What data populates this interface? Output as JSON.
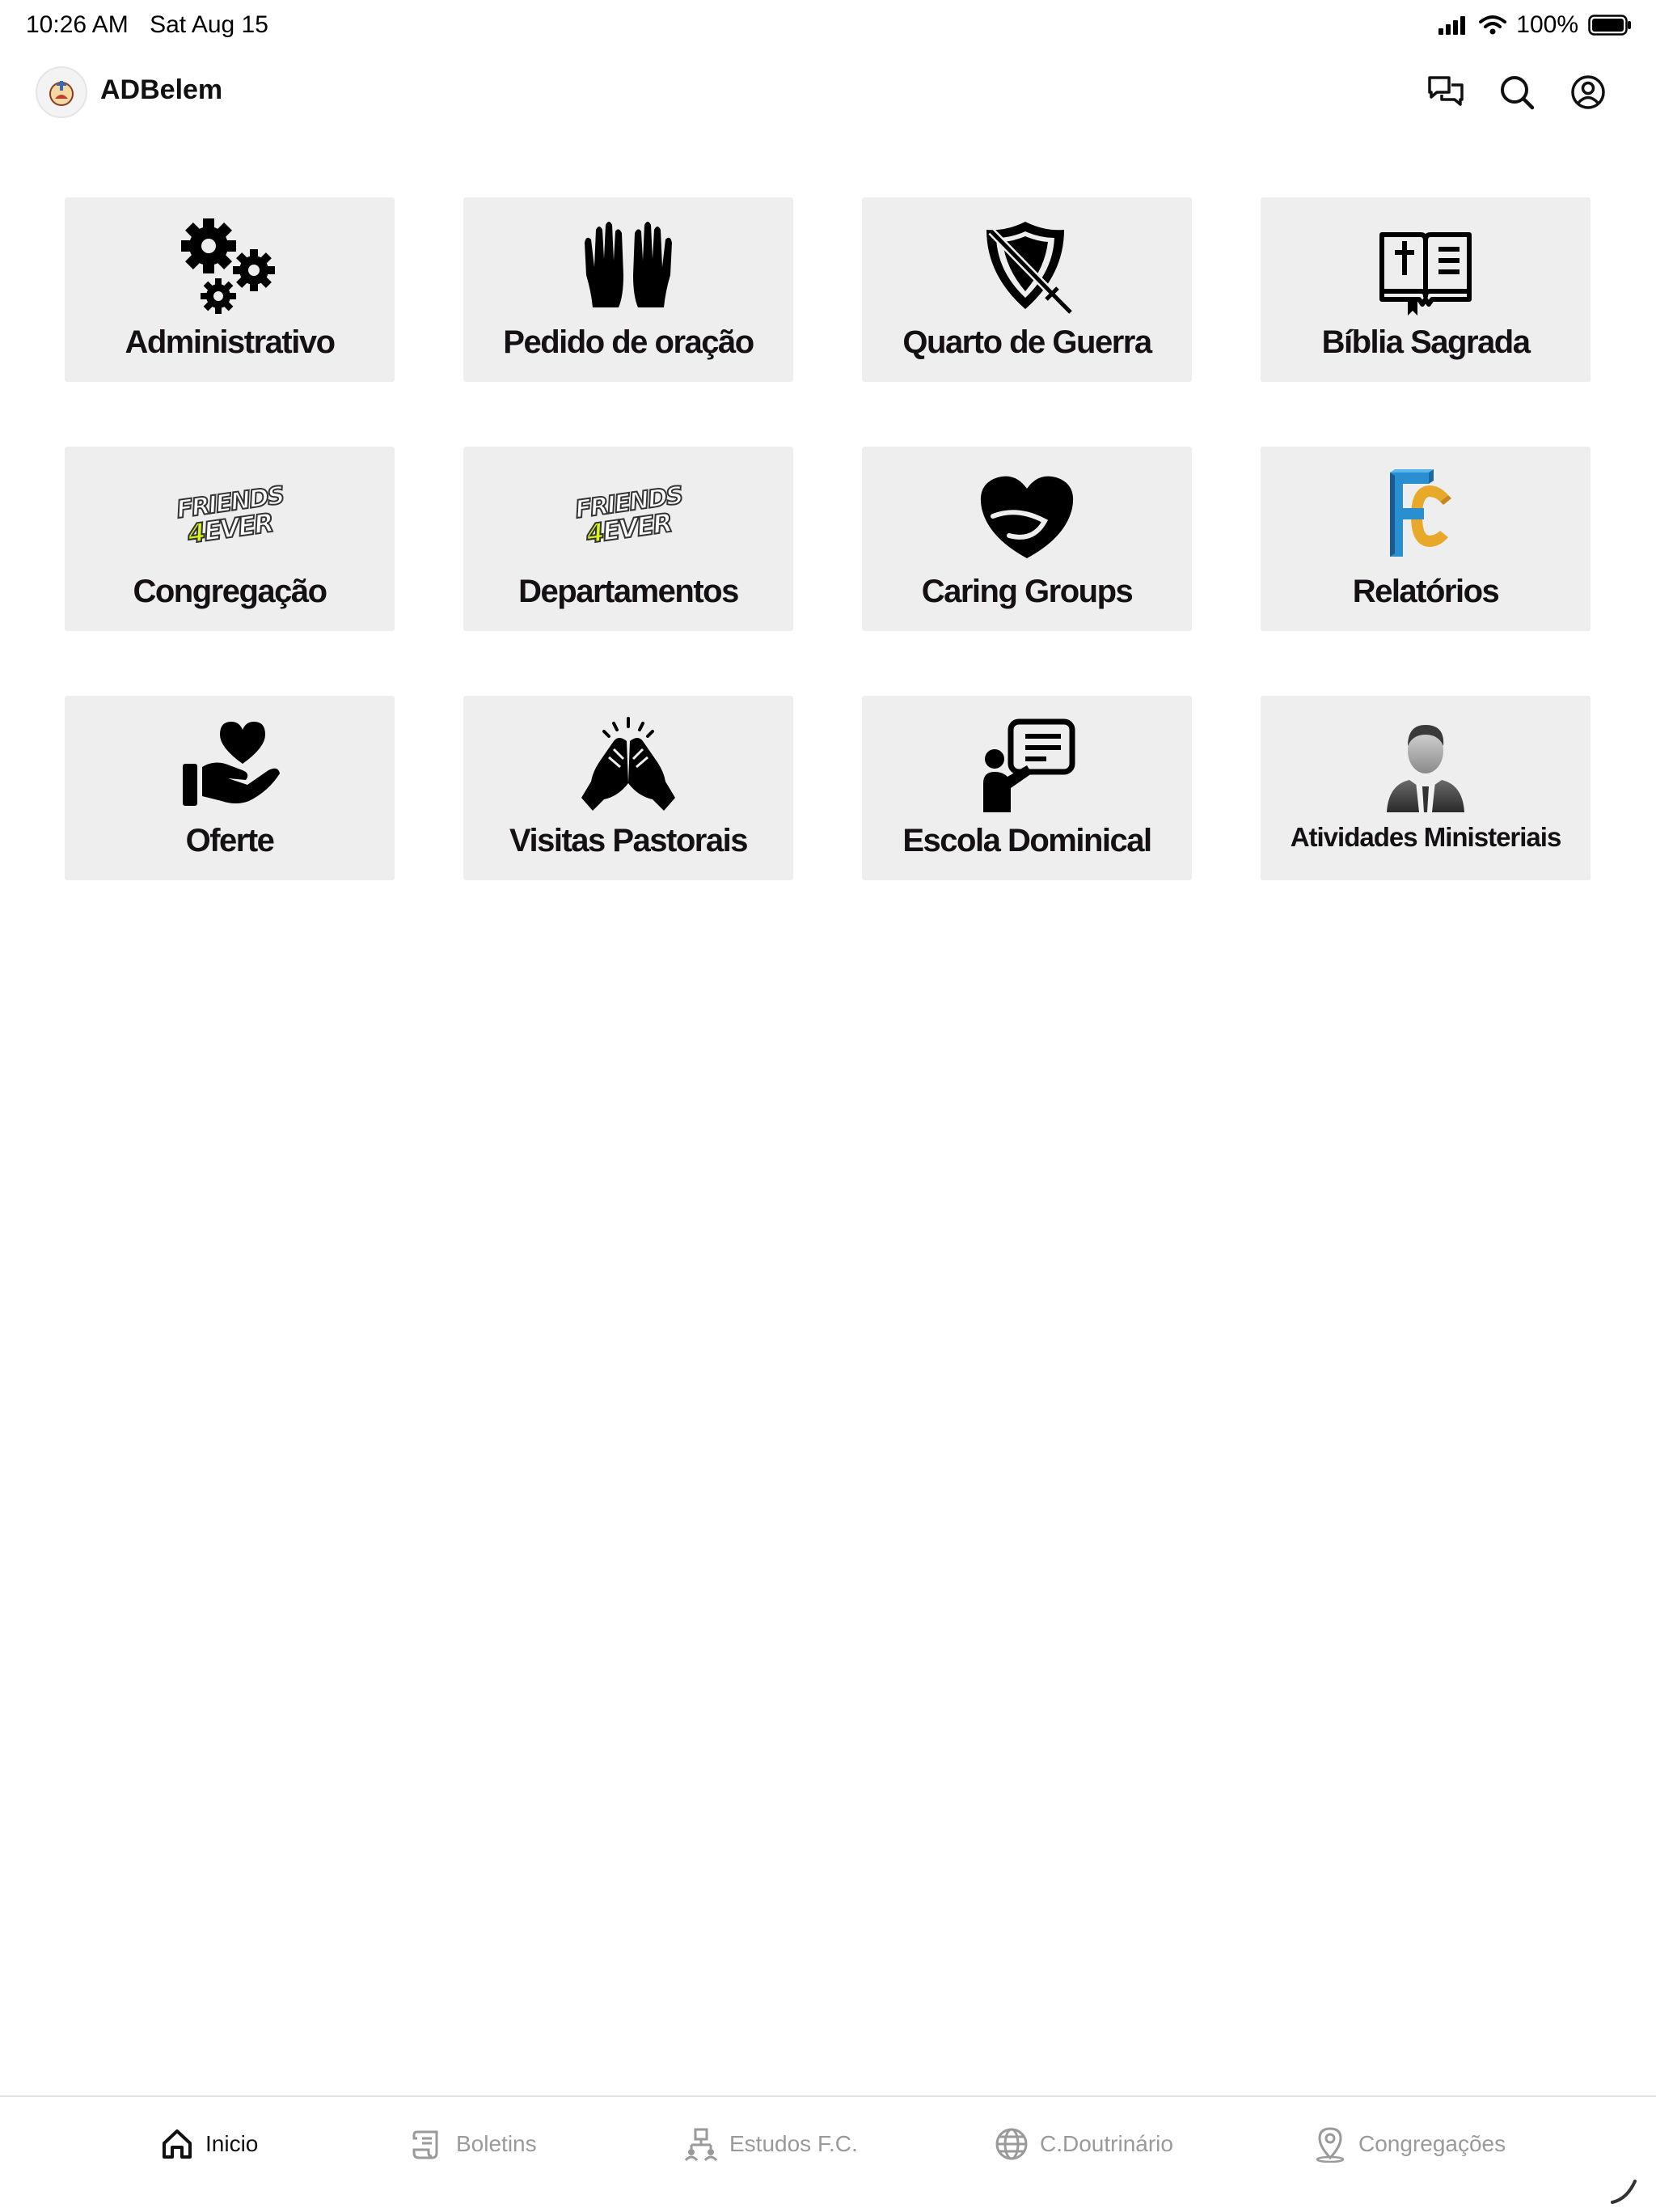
{
  "status": {
    "time": "10:26 AM",
    "date": "Sat Aug 15",
    "battery": "100%"
  },
  "header": {
    "title": "ADBelem"
  },
  "tiles": [
    {
      "label": "Administrativo",
      "icon": "gears-icon"
    },
    {
      "label": "Pedido de oração",
      "icon": "praying-hands-icon"
    },
    {
      "label": "Quarto de Guerra",
      "icon": "shield-sword-icon"
    },
    {
      "label": "Bíblia Sagrada",
      "icon": "bible-icon"
    },
    {
      "label": "Congregação",
      "icon": "friends-4ever-logo"
    },
    {
      "label": "Departamentos",
      "icon": "friends-4ever-logo"
    },
    {
      "label": "Caring Groups",
      "icon": "heart-leaf-icon"
    },
    {
      "label": "Relatórios",
      "icon": "fc-logo"
    },
    {
      "label": "Oferte",
      "icon": "heart-hand-icon"
    },
    {
      "label": "Visitas Pastorais",
      "icon": "high-five-icon"
    },
    {
      "label": "Escola Dominical",
      "icon": "teacher-board-icon"
    },
    {
      "label": "Atividades Ministeriais",
      "icon": "businessman-icon"
    }
  ],
  "logo_text": {
    "f4e_top": "FRIENDS",
    "f4e_bottom_accent": "4",
    "f4e_bottom_rest": "EVER"
  },
  "tabs": [
    {
      "label": "Inicio",
      "icon": "home-icon",
      "active": true
    },
    {
      "label": "Boletins",
      "icon": "scroll-icon",
      "active": false
    },
    {
      "label": "Estudos F.C.",
      "icon": "org-chart-icon",
      "active": false
    },
    {
      "label": "C.Doutrinário",
      "icon": "globe-icon",
      "active": false
    },
    {
      "label": "Congregações",
      "icon": "location-pin-icon",
      "active": false
    }
  ],
  "colors": {
    "tile_bg": "#eeeeee",
    "tab_inactive": "#9a9a9a",
    "tab_active": "#111111",
    "accent_yellow": "#d9f21a"
  }
}
